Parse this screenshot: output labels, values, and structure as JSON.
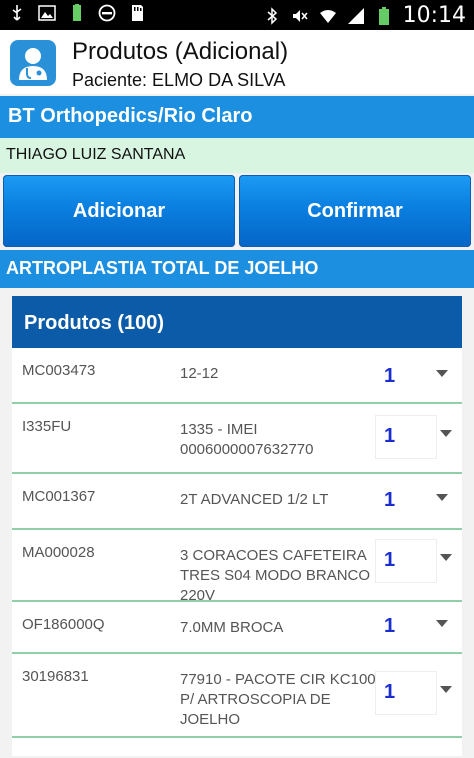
{
  "status_bar": {
    "time": "10:14",
    "battery_percent_label": "100%",
    "icons": [
      "usb-icon",
      "image-icon",
      "battery-charging-icon",
      "blocked-icon",
      "sd-card-icon",
      "bluetooth-icon",
      "mute-icon",
      "wifi-icon",
      "signal-icon",
      "battery-icon"
    ]
  },
  "header": {
    "title": "Produtos (Adicional)",
    "subtitle": "Paciente: ELMO DA SILVA"
  },
  "company": "BT Orthopedics/Rio Claro",
  "doctor": "THIAGO LUIZ SANTANA",
  "buttons": {
    "add": "Adicionar",
    "confirm": "Confirmar"
  },
  "procedure": "ARTROPLASTIA TOTAL DE JOELHO",
  "products": {
    "heading": "Produtos (100)",
    "items": [
      {
        "code": "MC003473",
        "desc": "12-12",
        "qty": "1"
      },
      {
        "code": "I335FU",
        "desc": "1335 - IMEI 0006000007632770",
        "qty": "1"
      },
      {
        "code": "MC001367",
        "desc": "2T ADVANCED 1/2 LT",
        "qty": "1"
      },
      {
        "code": "MA000028",
        "desc": "3 CORACOES CAFETEIRA TRES S04 MODO BRANCO 220V",
        "qty": "1"
      },
      {
        "code": "OF186000Q",
        "desc": "7.0MM BROCA",
        "qty": "1"
      },
      {
        "code": "30196831",
        "desc": "77910 - PACOTE CIR KC100 P/ ARTROSCOPIA DE JOELHO",
        "qty": "1"
      }
    ]
  }
}
